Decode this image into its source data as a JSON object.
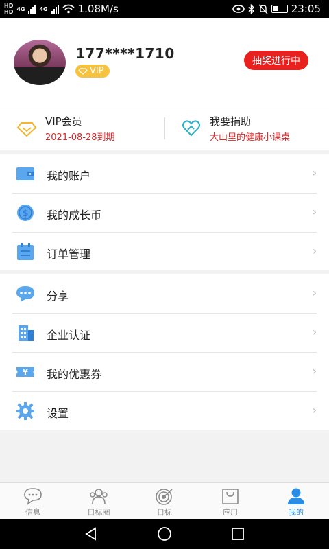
{
  "status_bar": {
    "net_label_1": "HD",
    "net_label_2": "HD",
    "net_type_1": "4G",
    "net_type_2": "4G",
    "speed": "1.08M/s",
    "time": "23:05"
  },
  "profile": {
    "phone": "177****1710",
    "vip_badge": "VIP",
    "lottery_button": "抽奖进行中"
  },
  "vip_row": {
    "vip": {
      "title": "VIP会员",
      "subtitle": "2021-08-28到期"
    },
    "donate": {
      "title": "我要捐助",
      "subtitle": "大山里的健康小课桌"
    }
  },
  "menu_group_1": [
    {
      "label": "我的账户",
      "icon": "wallet-icon"
    },
    {
      "label": "我的成长币",
      "icon": "coin-icon"
    },
    {
      "label": "订单管理",
      "icon": "order-icon"
    }
  ],
  "menu_group_2": [
    {
      "label": "分享",
      "icon": "share-chat-icon"
    },
    {
      "label": "企业认证",
      "icon": "building-icon"
    },
    {
      "label": "我的优惠券",
      "icon": "coupon-icon"
    },
    {
      "label": "设置",
      "icon": "gear-icon"
    }
  ],
  "chevron": "›",
  "tabs": [
    {
      "label": "信息",
      "icon": "chat-icon",
      "active": false
    },
    {
      "label": "目标圈",
      "icon": "group-icon",
      "active": false
    },
    {
      "label": "目标",
      "icon": "target-icon",
      "active": false
    },
    {
      "label": "应用",
      "icon": "bag-icon",
      "active": false
    },
    {
      "label": "我的",
      "icon": "user-icon",
      "active": true
    }
  ],
  "colors": {
    "accent": "#2a8de6",
    "lottery": "#e8211f",
    "vip_gold": "#f7c23e",
    "red_text": "#d8282a"
  }
}
